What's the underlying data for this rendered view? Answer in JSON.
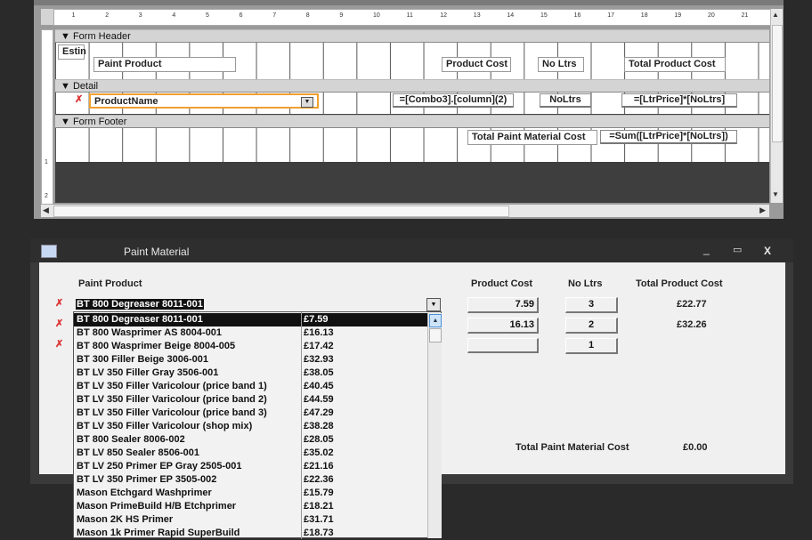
{
  "design_view": {
    "ruler_marks": [
      "1",
      "2",
      "3",
      "4",
      "5",
      "6",
      "7",
      "8",
      "9",
      "10",
      "11",
      "12",
      "13",
      "14",
      "15",
      "16",
      "17",
      "18",
      "19",
      "20",
      "21"
    ],
    "vruler_marks": [
      "1",
      "2"
    ],
    "sections": {
      "header": "Form Header",
      "detail": "Detail",
      "footer": "Form Footer"
    },
    "header_controls": {
      "estin": "Estin",
      "paint_product": "Paint Product",
      "product_cost": "Product Cost",
      "no_ltrs": "No Ltrs",
      "total_product_cost": "Total Product Cost"
    },
    "detail_controls": {
      "combo": "ProductName",
      "cost_expr": "=[Combo3].[column](2)",
      "no_ltrs": "NoLtrs",
      "total_expr": "=[LtrPrice]*[NoLtrs]"
    },
    "footer_controls": {
      "label": "Total Paint Material Cost",
      "sum_expr": "=Sum([LtrPrice]*[NoLtrs])"
    }
  },
  "form": {
    "title": "Paint Material",
    "headers": {
      "paint_product": "Paint Product",
      "product_cost": "Product Cost",
      "no_ltrs": "No Ltrs",
      "total_product_cost": "Total Product Cost"
    },
    "combo_value": "BT 800 Degreaser 8011-001",
    "records": [
      {
        "cost": "7.59",
        "ltrs": "3",
        "total": "£22.77"
      },
      {
        "cost": "16.13",
        "ltrs": "2",
        "total": "£32.26"
      },
      {
        "cost": "",
        "ltrs": "1",
        "total": ""
      }
    ],
    "footer_label": "Total Paint Material Cost",
    "footer_value": "£0.00",
    "dropdown": [
      {
        "name": "BT 800 Degreaser 8011-001",
        "price": "£7.59"
      },
      {
        "name": "BT 800 Wasprimer AS 8004-001",
        "price": "£16.13"
      },
      {
        "name": "BT 800 Wasprimer Beige 8004-005",
        "price": "£17.42"
      },
      {
        "name": "BT 300 Filler Beige 3006-001",
        "price": "£32.93"
      },
      {
        "name": "BT LV 350 Filler Gray 3506-001",
        "price": "£38.05"
      },
      {
        "name": "BT LV 350 Filler Varicolour (price band 1)",
        "price": "£40.45"
      },
      {
        "name": "BT LV 350 Filler Varicolour (price band 2)",
        "price": "£44.59"
      },
      {
        "name": "BT LV 350 Filler Varicolour (price band 3)",
        "price": "£47.29"
      },
      {
        "name": "BT LV 350 Filler Varicolour (shop mix)",
        "price": "£38.28"
      },
      {
        "name": "BT 800 Sealer 8006-002",
        "price": "£28.05"
      },
      {
        "name": "BT LV 850 Sealer 8506-001",
        "price": "£35.02"
      },
      {
        "name": "BT LV 250 Primer EP Gray 2505-001",
        "price": "£21.16"
      },
      {
        "name": "BT LV 350 Primer EP 3505-002",
        "price": "£22.36"
      },
      {
        "name": "Mason Etchgard Washprimer",
        "price": "£15.79"
      },
      {
        "name": "Mason PrimeBuild H/B Etchprimer",
        "price": "£18.21"
      },
      {
        "name": "Mason 2K HS Primer",
        "price": "£31.71"
      },
      {
        "name": "Mason 1k Primer Rapid SuperBuild",
        "price": "£18.73"
      }
    ]
  }
}
